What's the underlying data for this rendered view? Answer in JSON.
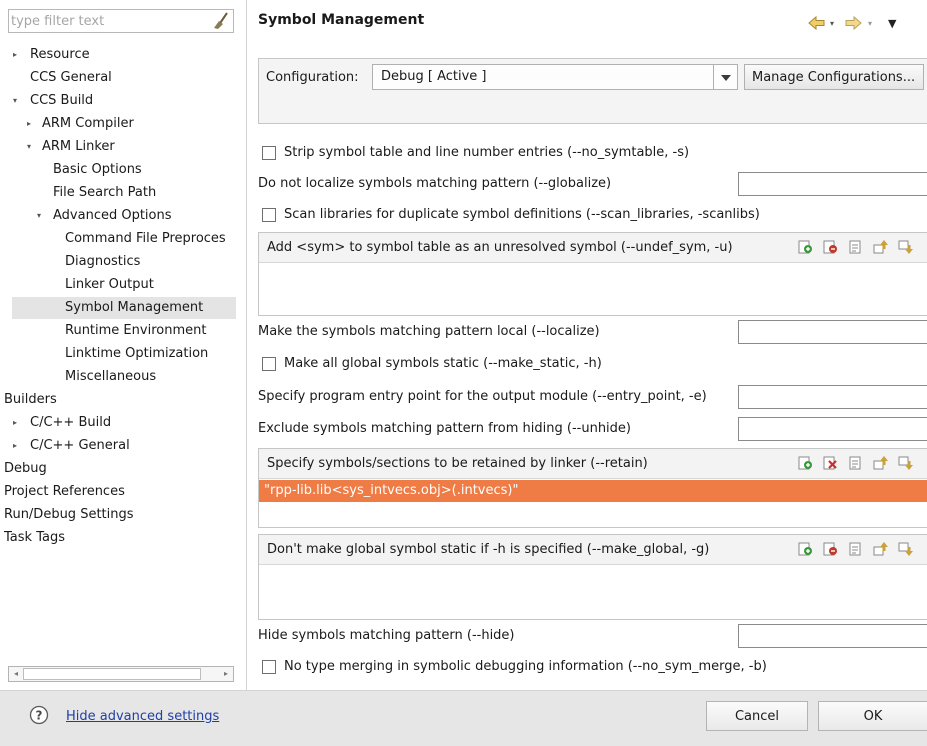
{
  "filter": {
    "placeholder": "type filter text",
    "clear_icon": "broom-clear-icon"
  },
  "tree": {
    "items": [
      {
        "label": "Resource",
        "toggle": "▸"
      },
      {
        "label": "CCS General"
      },
      {
        "label": "CCS Build",
        "toggle": "▾"
      },
      {
        "label": "ARM Compiler",
        "toggle": "▸"
      },
      {
        "label": "ARM Linker",
        "toggle": "▾"
      },
      {
        "label": "Basic Options"
      },
      {
        "label": "File Search Path"
      },
      {
        "label": "Advanced Options",
        "toggle": "▾"
      },
      {
        "label": "Command File Preproces"
      },
      {
        "label": "Diagnostics"
      },
      {
        "label": "Linker Output"
      },
      {
        "label": "Symbol Management"
      },
      {
        "label": "Runtime Environment"
      },
      {
        "label": "Linktime Optimization"
      },
      {
        "label": "Miscellaneous"
      },
      {
        "label": "Builders"
      },
      {
        "label": "C/C++ Build",
        "toggle": "▸"
      },
      {
        "label": "C/C++ General",
        "toggle": "▸"
      },
      {
        "label": "Debug"
      },
      {
        "label": "Project References"
      },
      {
        "label": "Run/Debug Settings"
      },
      {
        "label": "Task Tags"
      }
    ]
  },
  "header": {
    "title": "Symbol Management",
    "nav": {
      "back_icon": "back-arrow-icon",
      "forward_icon": "forward-arrow-icon",
      "menu_icon": "view-menu-icon"
    }
  },
  "configuration": {
    "label": "Configuration:",
    "value": "Debug  [ Active ]",
    "manage_label": "Manage Configurations..."
  },
  "options": {
    "strip_symtable": "Strip symbol table and line number entries (--no_symtable, -s)",
    "globalize": "Do not localize symbols matching pattern (--globalize)",
    "scan_libraries": "Scan libraries for duplicate symbol definitions (--scan_libraries, -scanlibs)",
    "undef_sym": "Add <sym> to symbol table as an unresolved symbol (--undef_sym, -u)",
    "localize": "Make the symbols matching pattern local (--localize)",
    "make_static": "Make all global symbols static (--make_static, -h)",
    "entry_point": "Specify program entry point for the output module (--entry_point, -e)",
    "unhide": "Exclude symbols matching pattern from hiding (--unhide)",
    "retain": "Specify symbols/sections to be retained by linker (--retain)",
    "retain_items": [
      "\"rpp-lib.lib<sys_intvecs.obj>(.intvecs)\""
    ],
    "make_global": "Don't make global symbol static if -h is specified (--make_global, -g)",
    "hide": "Hide symbols matching pattern (--hide)",
    "no_sym_merge": "No type merging in symbolic debugging information (--no_sym_merge, -b)"
  },
  "list_tools": [
    "add-icon",
    "delete-icon",
    "edit-icon",
    "move-up-icon",
    "move-down-icon"
  ],
  "footer": {
    "help_link": "Hide advanced settings",
    "cancel": "Cancel",
    "ok": "OK"
  },
  "colors": {
    "selection": "#ef7b45",
    "link": "#1f3fa6"
  }
}
